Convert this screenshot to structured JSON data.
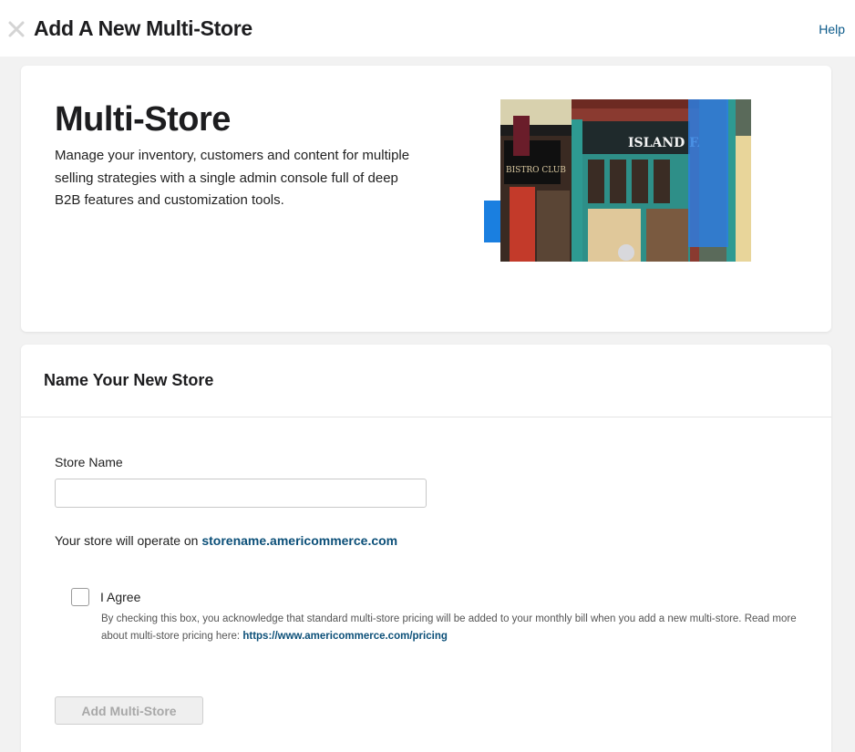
{
  "header": {
    "title": "Add A New Multi-Store",
    "help_label": "Help",
    "close_icon": "close-icon"
  },
  "hero": {
    "title": "Multi-Store",
    "description": "Manage your inventory, customers and content for multiple selling strategies with a single admin console full of deep B2B features and customization tools.",
    "accent_color": "#1a7fe0",
    "image_signs": [
      "ISLAND FA",
      "BISTRO CLUB"
    ]
  },
  "form": {
    "section_title": "Name Your New Store",
    "store_name_label": "Store Name",
    "store_name_value": "",
    "store_name_placeholder": "",
    "domain_prefix": "Your store will operate on",
    "domain": "storename.americommerce.com",
    "agree_label": "I Agree",
    "agree_checked": false,
    "agree_note": "By checking this box, you acknowledge that standard multi-store pricing will be added to your monthly bill when you add a new multi-store. Read more about multi-store pricing here:",
    "pricing_link": "https://www.americommerce.com/pricing",
    "submit_label": "Add Multi-Store",
    "submit_disabled": true
  },
  "colors": {
    "link": "#0b5a8a",
    "background": "#f2f2f2",
    "card": "#ffffff"
  }
}
